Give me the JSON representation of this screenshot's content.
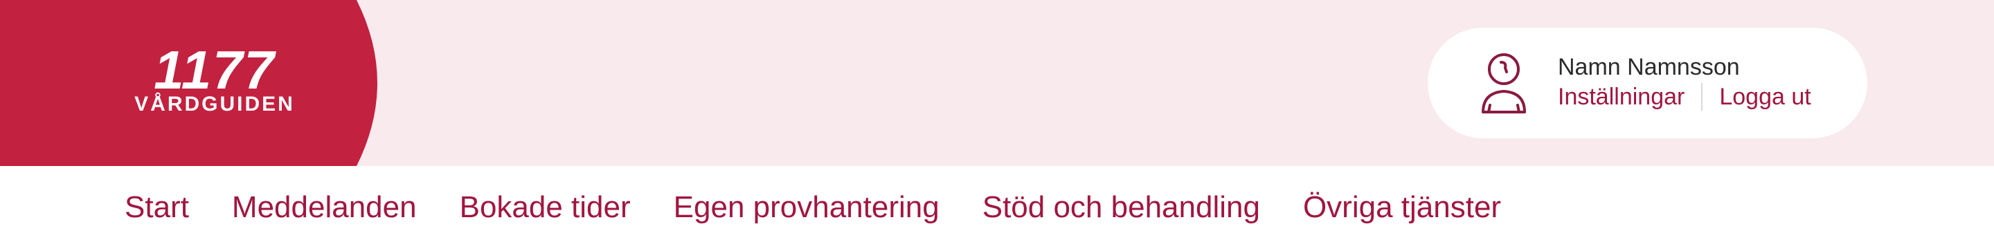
{
  "colors": {
    "brand": "#c22140",
    "header_bg": "#f9eaed",
    "link": "#a0163f",
    "text": "#2b2b2b"
  },
  "logo": {
    "number": "1177",
    "name": "VÅRDGUIDEN"
  },
  "user": {
    "icon": "user-avatar-icon",
    "name": "Namn Namnsson",
    "settings_label": "Inställningar",
    "logout_label": "Logga ut"
  },
  "nav": {
    "items": [
      {
        "label": "Start"
      },
      {
        "label": "Meddelanden"
      },
      {
        "label": "Bokade tider"
      },
      {
        "label": "Egen provhantering"
      },
      {
        "label": "Stöd och behandling"
      },
      {
        "label": "Övriga tjänster"
      }
    ]
  }
}
